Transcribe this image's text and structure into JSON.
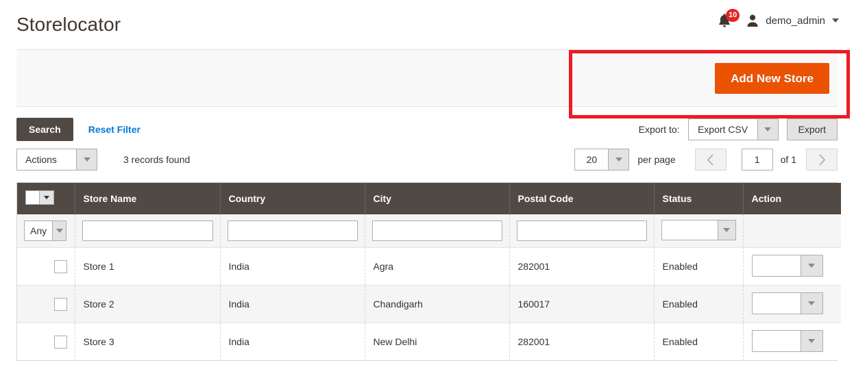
{
  "header": {
    "title": "Storelocator",
    "notifications": {
      "icon": "bell-icon",
      "count": "10"
    },
    "user": {
      "avatar_icon": "user-avatar-icon",
      "name": "demo_admin",
      "caret_icon": "caret-down-icon"
    }
  },
  "page_actions": {
    "add_new_store_label": "Add New Store",
    "accent_color": "#eb5202"
  },
  "annotation": {
    "color": "#ec1c24"
  },
  "toolbar": {
    "search_label": "Search",
    "reset_filter_label": "Reset Filter",
    "actions_label": "Actions",
    "records_found": "3 records found",
    "export_to_label": "Export to:",
    "export_format": "Export CSV",
    "export_button_label": "Export"
  },
  "pagination": {
    "per_page_value": "20",
    "per_page_label": "per page",
    "prev_icon": "chevron-left-icon",
    "next_icon": "chevron-right-icon",
    "current_page": "1",
    "of_label": "of 1"
  },
  "grid": {
    "columns": [
      {
        "key": "checkbox",
        "label": ""
      },
      {
        "key": "store_name",
        "label": "Store Name"
      },
      {
        "key": "country",
        "label": "Country"
      },
      {
        "key": "city",
        "label": "City"
      },
      {
        "key": "postal_code",
        "label": "Postal Code"
      },
      {
        "key": "status",
        "label": "Status"
      },
      {
        "key": "action",
        "label": "Action"
      }
    ],
    "filters": {
      "mass_select_value": "Any",
      "store_name": "",
      "country": "",
      "city": "",
      "postal_code": "",
      "status": ""
    },
    "rows": [
      {
        "store_name": "Store 1",
        "country": "India",
        "city": "Agra",
        "postal_code": "282001",
        "status": "Enabled",
        "action": ""
      },
      {
        "store_name": "Store 2",
        "country": "India",
        "city": "Chandigarh",
        "postal_code": "160017",
        "status": "Enabled",
        "action": ""
      },
      {
        "store_name": "Store 3",
        "country": "India",
        "city": "New Delhi",
        "postal_code": "282001",
        "status": "Enabled",
        "action": ""
      }
    ]
  }
}
